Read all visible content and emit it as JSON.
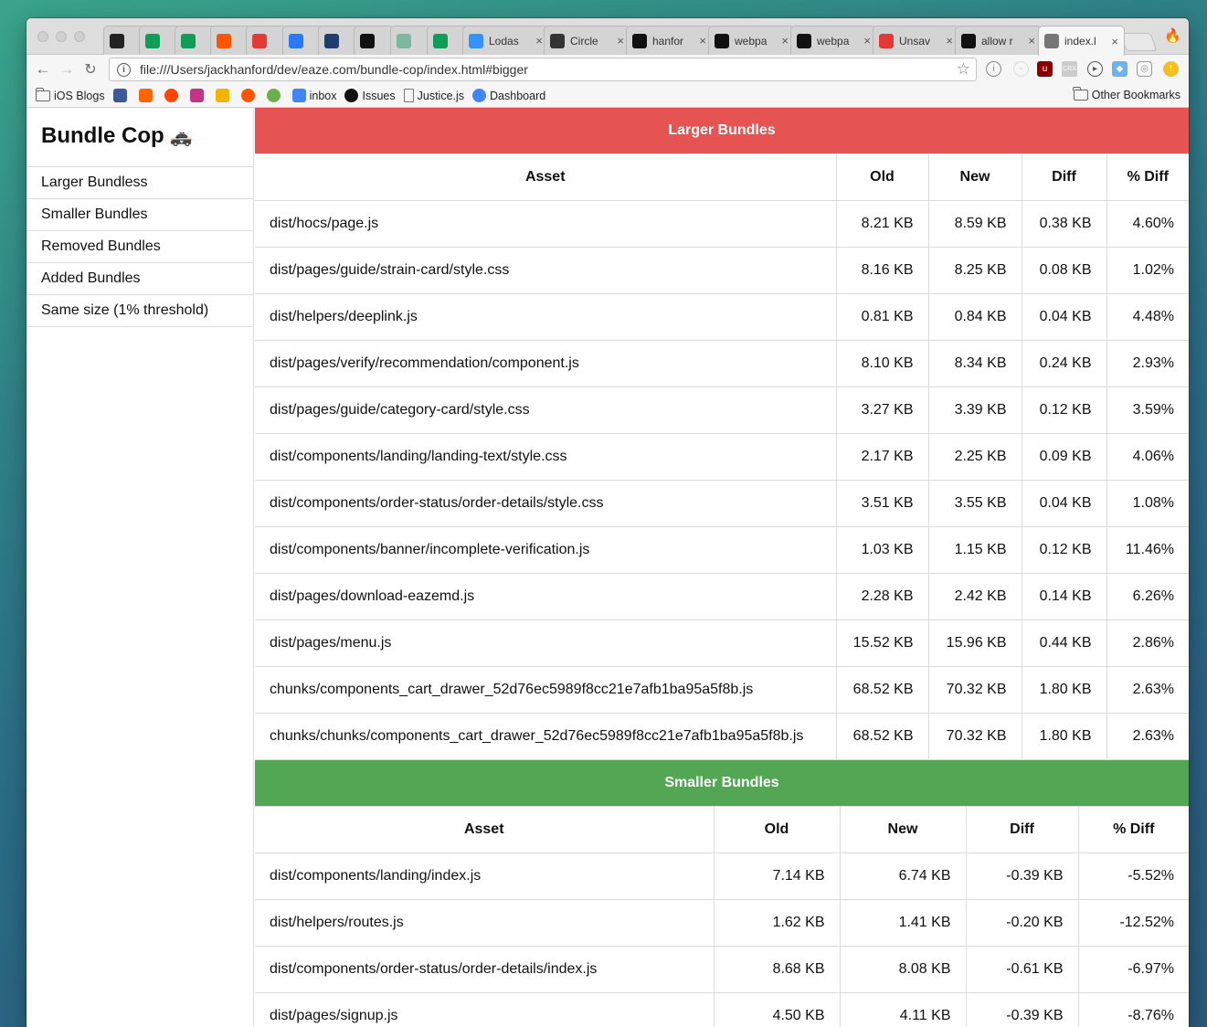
{
  "browser": {
    "tabs": [
      {
        "title": "",
        "icon": "stackshare-icon",
        "color": "#222222"
      },
      {
        "title": "",
        "icon": "sheets-icon",
        "color": "#0f9d58"
      },
      {
        "title": "",
        "icon": "sheets-icon",
        "color": "#0f9d58"
      },
      {
        "title": "",
        "icon": "music-icon",
        "color": "#ff5500"
      },
      {
        "title": "",
        "icon": "cr-icon",
        "color": "#e53935"
      },
      {
        "title": "",
        "icon": "messenger-icon",
        "color": "#2979ff"
      },
      {
        "title": "",
        "icon": "spade-icon",
        "color": "#1e3f6e"
      },
      {
        "title": "",
        "icon": "s-icon",
        "color": "#111111"
      },
      {
        "title": "",
        "icon": "image-icon",
        "color": "#7fb6a0"
      },
      {
        "title": "",
        "icon": "sheets-icon",
        "color": "#0f9d58"
      },
      {
        "title": "Lodas",
        "icon": "lodash-icon",
        "color": "#3492ff"
      },
      {
        "title": "Circle",
        "icon": "circleci-icon",
        "color": "#333333"
      },
      {
        "title": "hanfor",
        "icon": "github-icon",
        "color": "#111111"
      },
      {
        "title": "webpa",
        "icon": "github-icon",
        "color": "#111111"
      },
      {
        "title": "webpa",
        "icon": "github-icon",
        "color": "#111111"
      },
      {
        "title": "Unsav",
        "icon": "cr-icon",
        "color": "#e53935"
      },
      {
        "title": "allow r",
        "icon": "github-icon",
        "color": "#111111"
      },
      {
        "title": "index.l",
        "icon": "file-icon",
        "color": "#777777"
      }
    ],
    "url": "file:///Users/jackhanford/dev/eaze.com/bundle-cop/index.html#bigger",
    "bookmarks": [
      {
        "label": "iOS Blogs",
        "icon": "folder-icon",
        "color": ""
      },
      {
        "label": "",
        "icon": "facebook-icon",
        "color": "#3b5998"
      },
      {
        "label": "",
        "icon": "ycombinator-icon",
        "color": "#ff6600"
      },
      {
        "label": "",
        "icon": "reddit-icon",
        "color": "#ff4500"
      },
      {
        "label": "",
        "icon": "instagram-icon",
        "color": "#c13584"
      },
      {
        "label": "",
        "icon": "analytics-icon",
        "color": "#f4b400"
      },
      {
        "label": "",
        "icon": "music-icon",
        "color": "#ff5500"
      },
      {
        "label": "",
        "icon": "globe-icon",
        "color": "#6ab04c"
      },
      {
        "label": "inbox",
        "icon": "inbox-icon",
        "color": "#4285f4"
      },
      {
        "label": "Issues",
        "icon": "github-icon",
        "color": "#111111"
      },
      {
        "label": "Justice.js",
        "icon": "file-icon",
        "color": ""
      },
      {
        "label": "Dashboard",
        "icon": "google-icon",
        "color": "#4285f4"
      }
    ],
    "other_bookmarks": "Other Bookmarks"
  },
  "sidebar": {
    "title": "Bundle Cop",
    "emoji": "🚓",
    "items": [
      {
        "label": "Larger Bundless"
      },
      {
        "label": "Smaller Bundles"
      },
      {
        "label": "Removed Bundles"
      },
      {
        "label": "Added Bundles"
      },
      {
        "label": "Same size (1% threshold)"
      }
    ]
  },
  "larger": {
    "title": "Larger Bundles",
    "color": "#e55353",
    "columns": [
      "Asset",
      "Old",
      "New",
      "Diff",
      "% Diff"
    ],
    "rows": [
      [
        "dist/hocs/page.js",
        "8.21 KB",
        "8.59 KB",
        "0.38 KB",
        "4.60%"
      ],
      [
        "dist/pages/guide/strain-card/style.css",
        "8.16 KB",
        "8.25 KB",
        "0.08 KB",
        "1.02%"
      ],
      [
        "dist/helpers/deeplink.js",
        "0.81 KB",
        "0.84 KB",
        "0.04 KB",
        "4.48%"
      ],
      [
        "dist/pages/verify/recommendation/component.js",
        "8.10 KB",
        "8.34 KB",
        "0.24 KB",
        "2.93%"
      ],
      [
        "dist/pages/guide/category-card/style.css",
        "3.27 KB",
        "3.39 KB",
        "0.12 KB",
        "3.59%"
      ],
      [
        "dist/components/landing/landing-text/style.css",
        "2.17 KB",
        "2.25 KB",
        "0.09 KB",
        "4.06%"
      ],
      [
        "dist/components/order-status/order-details/style.css",
        "3.51 KB",
        "3.55 KB",
        "0.04 KB",
        "1.08%"
      ],
      [
        "dist/components/banner/incomplete-verification.js",
        "1.03 KB",
        "1.15 KB",
        "0.12 KB",
        "11.46%"
      ],
      [
        "dist/pages/download-eazemd.js",
        "2.28 KB",
        "2.42 KB",
        "0.14 KB",
        "6.26%"
      ],
      [
        "dist/pages/menu.js",
        "15.52 KB",
        "15.96 KB",
        "0.44 KB",
        "2.86%"
      ],
      [
        "chunks/components_cart_drawer_52d76ec5989f8cc21e7afb1ba95a5f8b.js",
        "68.52 KB",
        "70.32 KB",
        "1.80 KB",
        "2.63%"
      ],
      [
        "chunks/chunks/components_cart_drawer_52d76ec5989f8cc21e7afb1ba95a5f8b.js",
        "68.52 KB",
        "70.32 KB",
        "1.80 KB",
        "2.63%"
      ]
    ]
  },
  "smaller": {
    "title": "Smaller Bundles",
    "color": "#53a653",
    "columns": [
      "Asset",
      "Old",
      "New",
      "Diff",
      "% Diff"
    ],
    "rows": [
      [
        "dist/components/landing/index.js",
        "7.14 KB",
        "6.74 KB",
        "-0.39 KB",
        "-5.52%"
      ],
      [
        "dist/helpers/routes.js",
        "1.62 KB",
        "1.41 KB",
        "-0.20 KB",
        "-12.52%"
      ],
      [
        "dist/components/order-status/order-details/index.js",
        "8.68 KB",
        "8.08 KB",
        "-0.61 KB",
        "-6.97%"
      ],
      [
        "dist/pages/signup.js",
        "4.50 KB",
        "4.11 KB",
        "-0.39 KB",
        "-8.76%"
      ]
    ]
  }
}
